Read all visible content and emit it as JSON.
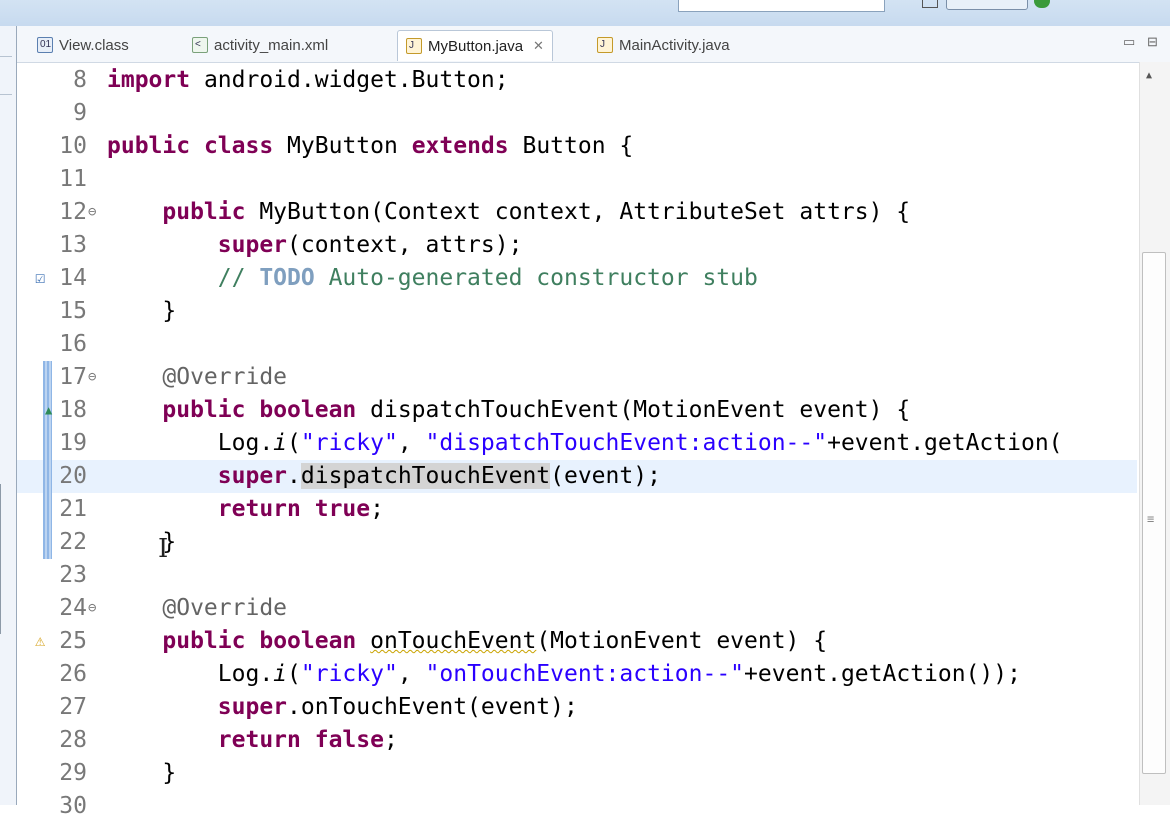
{
  "tabs": [
    {
      "label": "View.class",
      "icon": "class-file-icon",
      "active": false
    },
    {
      "label": "activity_main.xml",
      "icon": "xml-file-icon",
      "active": false
    },
    {
      "label": "MyButton.java",
      "icon": "java-file-icon",
      "active": true
    },
    {
      "label": "MainActivity.java",
      "icon": "java-file-icon",
      "active": false
    }
  ],
  "close_glyph": "✕",
  "window_controls": {
    "minimize": "▭",
    "maximize": "⊟"
  },
  "lines": [
    {
      "n": "8",
      "html": "<span class=\"kw\">import</span> android.widget.Button;"
    },
    {
      "n": "9",
      "html": ""
    },
    {
      "n": "10",
      "html": "<span class=\"kw\">public</span> <span class=\"kw\">class</span> MyButton <span class=\"kw\">extends</span> Button {"
    },
    {
      "n": "11",
      "html": ""
    },
    {
      "n": "12",
      "fold": "⊖",
      "html": "    <span class=\"kw\">public</span> MyButton(Context context, AttributeSet attrs) {"
    },
    {
      "n": "13",
      "html": "        <span class=\"kw\">super</span>(context, attrs);"
    },
    {
      "n": "14",
      "marker": "task",
      "html": "        <span class=\"com\">// </span><span class=\"todo\">TODO</span><span class=\"com\"> Auto-generated constructor stub</span>"
    },
    {
      "n": "15",
      "html": "    }"
    },
    {
      "n": "16",
      "html": ""
    },
    {
      "n": "17",
      "fold": "⊖",
      "diff": true,
      "html": "    <span class=\"ann\">@Override</span>"
    },
    {
      "n": "18",
      "diff": true,
      "marker": "override",
      "html": "    <span class=\"kw\">public</span> <span class=\"kw\">boolean</span> dispatchTouchEvent(MotionEvent event) {"
    },
    {
      "n": "19",
      "diff": true,
      "html": "        Log.<span class=\"it\">i</span>(<span class=\"str\">\"ricky\"</span>, <span class=\"str\">\"dispatchTouchEvent:action--\"</span>+event.getAction("
    },
    {
      "n": "20",
      "diff": true,
      "current": true,
      "html": "        <span class=\"kw\">super</span>.<span class=\"occ\">dispatchTouchEvent</span>(event);"
    },
    {
      "n": "21",
      "diff": true,
      "html": "        <span class=\"kw\">return</span> <span class=\"kw\">true</span>;"
    },
    {
      "n": "22",
      "diff": true,
      "html": "    }"
    },
    {
      "n": "23",
      "html": ""
    },
    {
      "n": "24",
      "fold": "⊖",
      "html": "    <span class=\"ann\">@Override</span>"
    },
    {
      "n": "25",
      "marker": "warning",
      "html": "    <span class=\"kw\">public</span> <span class=\"kw\">boolean</span> <span class=\"squig\">onTouchEvent</span>(MotionEvent event) {"
    },
    {
      "n": "26",
      "html": "        Log.<span class=\"it\">i</span>(<span class=\"str\">\"ricky\"</span>, <span class=\"str\">\"onTouchEvent:action--\"</span>+event.getAction());"
    },
    {
      "n": "27",
      "html": "        <span class=\"kw\">super</span>.onTouchEvent(event);"
    },
    {
      "n": "28",
      "html": "        <span class=\"kw\">return</span> <span class=\"kw\">false</span>;"
    },
    {
      "n": "29",
      "html": "    }"
    },
    {
      "n": "30",
      "html": ""
    }
  ],
  "marker_glyphs": {
    "task": "☑",
    "override": "▲",
    "warning": "⚠"
  }
}
